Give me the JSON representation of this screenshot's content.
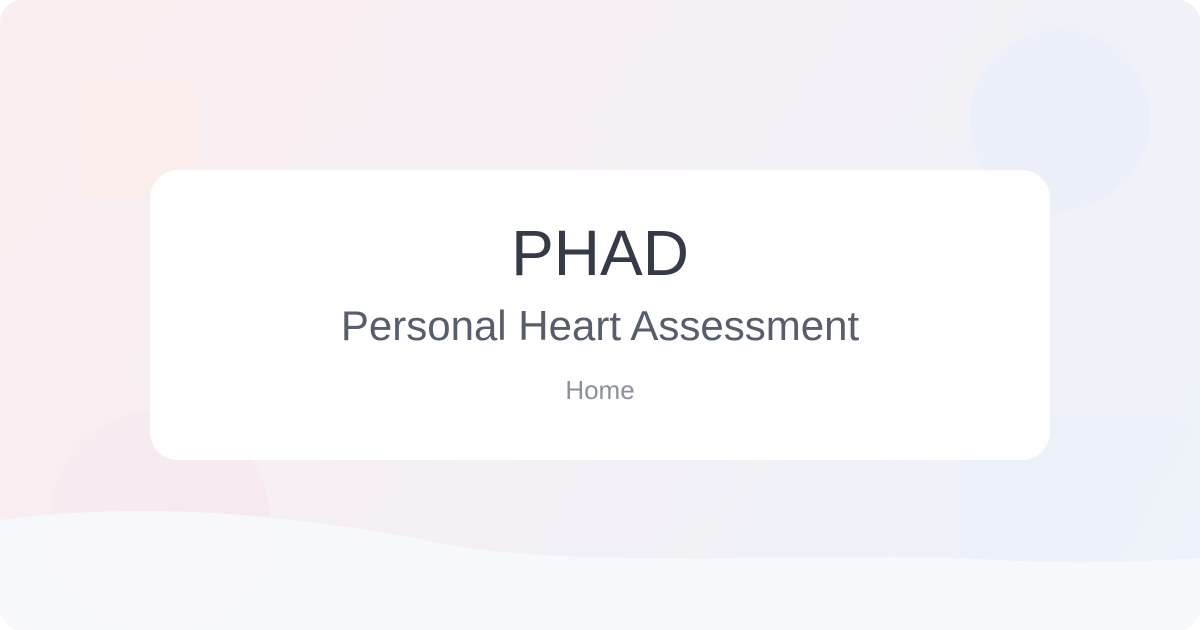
{
  "header": {
    "title": "PHAD",
    "subtitle": "Personal Heart Assessment"
  },
  "nav": {
    "home_label": "Home"
  },
  "colors": {
    "title_text": "#343b47",
    "subtitle_text": "#565d6b",
    "nav_text": "#8b9099",
    "card_background": "#ffffff",
    "page_background_start": "#fbeef0",
    "page_background_end": "#eef3fa"
  }
}
